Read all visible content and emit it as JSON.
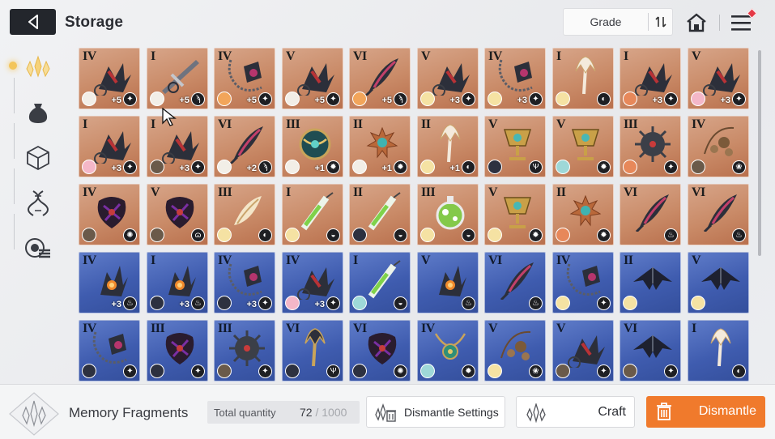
{
  "header": {
    "title": "Storage",
    "sort_label": "Grade"
  },
  "sidebar": {
    "items": [
      {
        "icon": "crystal-icon",
        "active": true
      },
      {
        "icon": "pouch-icon",
        "active": false
      },
      {
        "icon": "cube-icon",
        "active": false
      },
      {
        "icon": "helix-icon",
        "active": false
      },
      {
        "icon": "target-list-icon",
        "active": false
      }
    ]
  },
  "grid": {
    "rows": [
      [
        {
          "rank": "IV",
          "level": "+5",
          "theme": "orange",
          "art": "claw",
          "avatar": "#f2eee7",
          "elem": "✦"
        },
        {
          "rank": "I",
          "level": "+5",
          "theme": "orange",
          "art": "blade",
          "avatar": "#f2eee7",
          "elem": "ϡ"
        },
        {
          "rank": "IV",
          "level": "+5",
          "theme": "orange",
          "art": "chain",
          "avatar": "#f2a55a",
          "elem": "✦"
        },
        {
          "rank": "V",
          "level": "+5",
          "theme": "orange",
          "art": "claw",
          "avatar": "#f2eee7",
          "elem": "✦"
        },
        {
          "rank": "VI",
          "level": "+5",
          "theme": "orange",
          "art": "feather",
          "avatar": "#f2a55a",
          "elem": "ϡ"
        },
        {
          "rank": "V",
          "level": "+3",
          "theme": "orange",
          "art": "claw",
          "avatar": "#f5e2a3",
          "elem": "✦"
        },
        {
          "rank": "IV",
          "level": "+3",
          "theme": "orange",
          "art": "chain",
          "avatar": "#f5e2a3",
          "elem": "✦"
        },
        {
          "rank": "I",
          "level": "",
          "theme": "orange",
          "art": "trident",
          "avatar": "#f5e2a3",
          "elem": "◐"
        },
        {
          "rank": "I",
          "level": "+3",
          "theme": "orange",
          "art": "claw",
          "avatar": "#e7885a",
          "elem": "✦"
        },
        {
          "rank": "V",
          "level": "+3",
          "theme": "orange",
          "art": "claw",
          "avatar": "#f4b7c8",
          "elem": "✦"
        }
      ],
      [
        {
          "rank": "I",
          "level": "+3",
          "theme": "orange",
          "art": "claw",
          "avatar": "#f4b7c8",
          "elem": "✦"
        },
        {
          "rank": "I",
          "level": "+3",
          "theme": "orange",
          "art": "claw",
          "avatar": "#6a5a4a",
          "elem": "✦"
        },
        {
          "rank": "VI",
          "level": "+2",
          "theme": "orange",
          "art": "feather",
          "avatar": "#f2eee7",
          "elem": "ϡ"
        },
        {
          "rank": "III",
          "level": "+1",
          "theme": "orange",
          "art": "orb",
          "avatar": "#f2eee7",
          "elem": "✹"
        },
        {
          "rank": "II",
          "level": "+1",
          "theme": "orange",
          "art": "flower",
          "avatar": "#f2eee7",
          "elem": "✹"
        },
        {
          "rank": "II",
          "level": "+1",
          "theme": "orange",
          "art": "trident",
          "avatar": "#f5e2a3",
          "elem": "◐"
        },
        {
          "rank": "V",
          "level": "",
          "theme": "orange",
          "art": "chalice",
          "avatar": "#2d3140",
          "elem": "Ѱ"
        },
        {
          "rank": "V",
          "level": "",
          "theme": "orange",
          "art": "chalice",
          "avatar": "#9ed8d8",
          "elem": "✹"
        },
        {
          "rank": "III",
          "level": "",
          "theme": "orange",
          "art": "mine",
          "avatar": "#e7885a",
          "elem": "✦"
        },
        {
          "rank": "IV",
          "level": "",
          "theme": "orange",
          "art": "bead",
          "avatar": "#6a5a4a",
          "elem": "❀"
        }
      ],
      [
        {
          "rank": "IV",
          "level": "",
          "theme": "orange",
          "art": "dark",
          "avatar": "#6a5a4a",
          "elem": "✺"
        },
        {
          "rank": "V",
          "level": "",
          "theme": "orange",
          "art": "dark",
          "avatar": "#6a5a4a",
          "elem": "ɷ"
        },
        {
          "rank": "III",
          "level": "",
          "theme": "orange",
          "art": "feather-light",
          "avatar": "#f5e2a3",
          "elem": "◐"
        },
        {
          "rank": "I",
          "level": "",
          "theme": "orange",
          "art": "syringe",
          "avatar": "#f5e2a3",
          "elem": "◒"
        },
        {
          "rank": "II",
          "level": "",
          "theme": "orange",
          "art": "syringe",
          "avatar": "#2d3140",
          "elem": "◒"
        },
        {
          "rank": "III",
          "level": "",
          "theme": "orange",
          "art": "flask",
          "avatar": "#f5e2a3",
          "elem": "◒"
        },
        {
          "rank": "V",
          "level": "",
          "theme": "orange",
          "art": "chalice",
          "avatar": "#f5e2a3",
          "elem": "✹"
        },
        {
          "rank": "II",
          "level": "",
          "theme": "orange",
          "art": "flower",
          "avatar": "#e7885a",
          "elem": "✹"
        },
        {
          "rank": "VI",
          "level": "",
          "theme": "orange",
          "art": "feather",
          "avatar": "",
          "elem": "♨"
        },
        {
          "rank": "VI",
          "level": "",
          "theme": "orange",
          "art": "feather",
          "avatar": "",
          "elem": "♨"
        }
      ],
      [
        {
          "rank": "IV",
          "level": "+3",
          "theme": "blue",
          "art": "claw-fire",
          "avatar": "",
          "elem": "♨"
        },
        {
          "rank": "I",
          "level": "+3",
          "theme": "blue",
          "art": "claw-fire",
          "avatar": "#2d3140",
          "elem": "♨"
        },
        {
          "rank": "IV",
          "level": "+3",
          "theme": "blue",
          "art": "chain",
          "avatar": "#2d3140",
          "elem": "✦"
        },
        {
          "rank": "IV",
          "level": "+3",
          "theme": "blue",
          "art": "claw",
          "avatar": "#f4b7c8",
          "elem": "✦"
        },
        {
          "rank": "I",
          "level": "",
          "theme": "blue",
          "art": "syringe",
          "avatar": "#9ed8d8",
          "elem": "◒"
        },
        {
          "rank": "V",
          "level": "",
          "theme": "blue",
          "art": "claw-fire",
          "avatar": "",
          "elem": "♨"
        },
        {
          "rank": "VI",
          "level": "",
          "theme": "blue",
          "art": "feather",
          "avatar": "",
          "elem": "♨"
        },
        {
          "rank": "IV",
          "level": "",
          "theme": "blue",
          "art": "chain",
          "avatar": "#f5e2a3",
          "elem": "✦"
        },
        {
          "rank": "II",
          "level": "",
          "theme": "blue",
          "art": "wing",
          "avatar": "#f5e2a3",
          "elem": ""
        },
        {
          "rank": "V",
          "level": "",
          "theme": "blue",
          "art": "wing",
          "avatar": "#f5e2a3",
          "elem": ""
        }
      ],
      [
        {
          "rank": "IV",
          "level": "",
          "theme": "blue",
          "art": "chain",
          "avatar": "#2d3140",
          "elem": "✦"
        },
        {
          "rank": "III",
          "level": "",
          "theme": "blue",
          "art": "dark",
          "avatar": "#2d3140",
          "elem": "✦"
        },
        {
          "rank": "III",
          "level": "",
          "theme": "blue",
          "art": "mine",
          "avatar": "#6a5a4a",
          "elem": "✦"
        },
        {
          "rank": "VI",
          "level": "",
          "theme": "blue",
          "art": "trident-gold",
          "avatar": "#2d3140",
          "elem": "Ѱ"
        },
        {
          "rank": "VI",
          "level": "",
          "theme": "blue",
          "art": "dark",
          "avatar": "#2d3140",
          "elem": "✺"
        },
        {
          "rank": "IV",
          "level": "",
          "theme": "blue",
          "art": "necklace",
          "avatar": "#9ed8d8",
          "elem": "✹"
        },
        {
          "rank": "V",
          "level": "",
          "theme": "blue",
          "art": "bead",
          "avatar": "#f5e2a3",
          "elem": "❀"
        },
        {
          "rank": "V",
          "level": "",
          "theme": "blue",
          "art": "claw",
          "avatar": "#6a5a4a",
          "elem": "✦"
        },
        {
          "rank": "VI",
          "level": "",
          "theme": "blue",
          "art": "wing",
          "avatar": "#6a5a4a",
          "elem": "✦"
        },
        {
          "rank": "I",
          "level": "",
          "theme": "blue",
          "art": "trident",
          "avatar": "",
          "elem": "◐"
        }
      ]
    ]
  },
  "footer": {
    "section_label": "Memory Fragments",
    "quantity_label": "Total quantity",
    "quantity_value": "72",
    "quantity_max": "/ 1000",
    "dismantle_settings_label": "Dismantle Settings",
    "craft_label": "Craft",
    "dismantle_label": "Dismantle",
    "accent_color": "#f07a2c"
  }
}
